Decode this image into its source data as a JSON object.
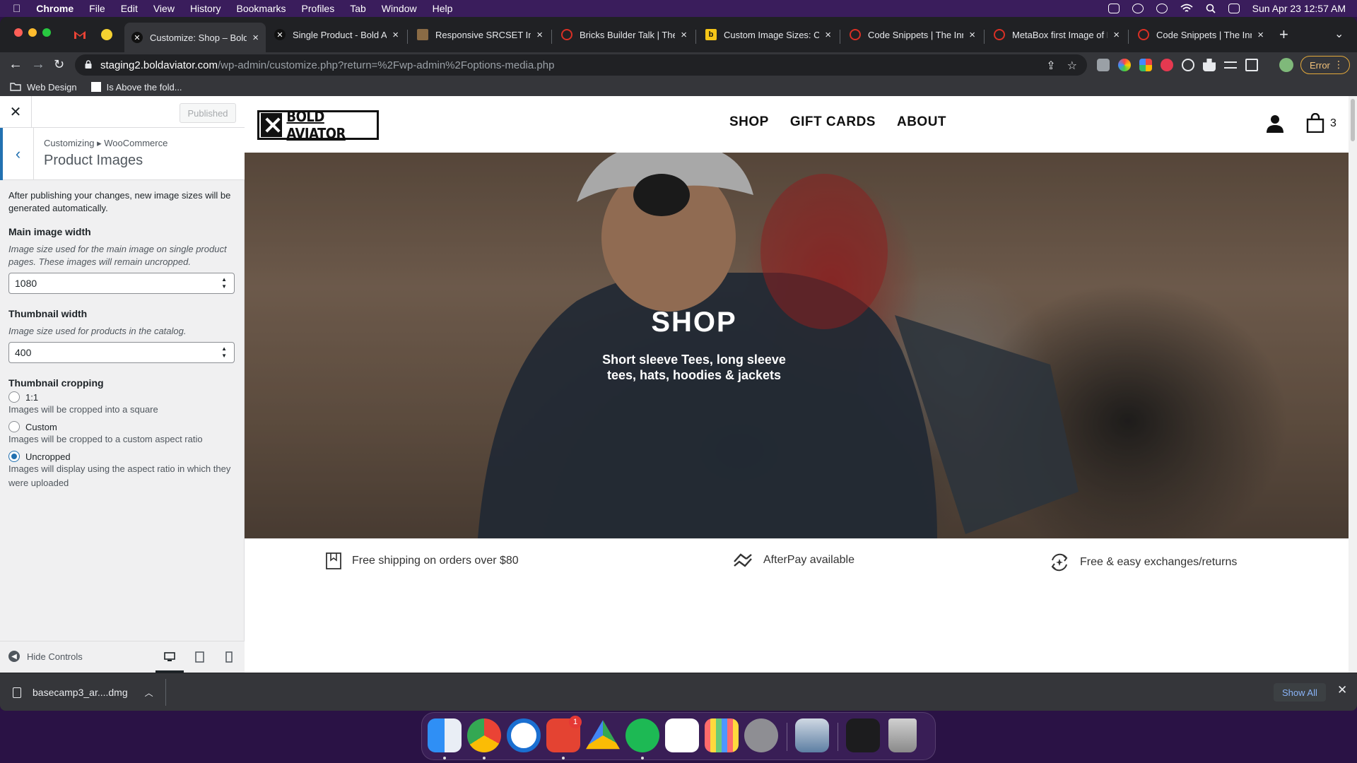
{
  "menubar": {
    "app_name": "Chrome",
    "menus": [
      "File",
      "Edit",
      "View",
      "History",
      "Bookmarks",
      "Profiles",
      "Tab",
      "Window",
      "Help"
    ],
    "clock": "Sun Apr 23  12:57 AM"
  },
  "tabs": [
    {
      "title": "Customize: Shop – Bold",
      "active": true
    },
    {
      "title": "Single Product - Bold Av"
    },
    {
      "title": "Responsive SRCSET Ima"
    },
    {
      "title": "Bricks Builder Talk | The"
    },
    {
      "title": "Custom Image Sizes: Ch"
    },
    {
      "title": "Code Snippets | The Inn"
    },
    {
      "title": "MetaBox first Image of In"
    },
    {
      "title": "Code Snippets | The Inn"
    }
  ],
  "address_bar": {
    "host": "staging2.boldaviator.com",
    "path": "/wp-admin/customize.php?return=%2Fwp-admin%2Foptions-media.php"
  },
  "profile": {
    "error_label": "Error"
  },
  "bookmarks": [
    "Web Design",
    "Is Above the fold..."
  ],
  "customizer": {
    "published_label": "Published",
    "breadcrumb": "Customizing ▸ WooCommerce",
    "section_title": "Product Images",
    "note": "After publishing your changes, new image sizes will be generated automatically.",
    "main_width": {
      "label": "Main image width",
      "description": "Image size used for the main image on single product pages. These images will remain uncropped.",
      "value": "1080"
    },
    "thumb_width": {
      "label": "Thumbnail width",
      "description": "Image size used for products in the catalog.",
      "value": "400"
    },
    "cropping": {
      "label": "Thumbnail cropping",
      "options": [
        {
          "label": "1:1",
          "description": "Images will be cropped into a square",
          "checked": false
        },
        {
          "label": "Custom",
          "description": "Images will be cropped to a custom aspect ratio",
          "checked": false
        },
        {
          "label": "Uncropped",
          "description": "Images will display using the aspect ratio in which they were uploaded",
          "checked": true
        }
      ]
    },
    "hide_controls_label": "Hide Controls"
  },
  "site": {
    "logo_text": "BOLD AVIATOR",
    "nav": [
      "SHOP",
      "GIFT CARDS",
      "ABOUT"
    ],
    "cart_count": "3",
    "hero_title": "SHOP",
    "hero_subtitle": "Short sleeve Tees, long sleeve tees, hats, hoodies & jackets",
    "perks": [
      "Free shipping on orders over $80",
      "AfterPay available",
      "Free & easy exchanges/returns"
    ]
  },
  "downloads": {
    "file_name": "basecamp3_ar....dmg",
    "show_all_label": "Show All"
  },
  "dock": {
    "apps": [
      "finder-icon",
      "chrome-icon",
      "1password-icon",
      "todoist-icon",
      "google-drive-icon",
      "spotify-icon",
      "freeform-icon",
      "launchpad-icon",
      "system-settings-icon",
      "preview-icon",
      "screen-capture-icon",
      "trash-icon"
    ],
    "todoist_badge": "1"
  },
  "colors": {
    "wp_blue": "#2271b1",
    "chrome_dark": "#202124",
    "chrome_toolbar": "#35363a",
    "error_amber": "#e4a93a"
  }
}
